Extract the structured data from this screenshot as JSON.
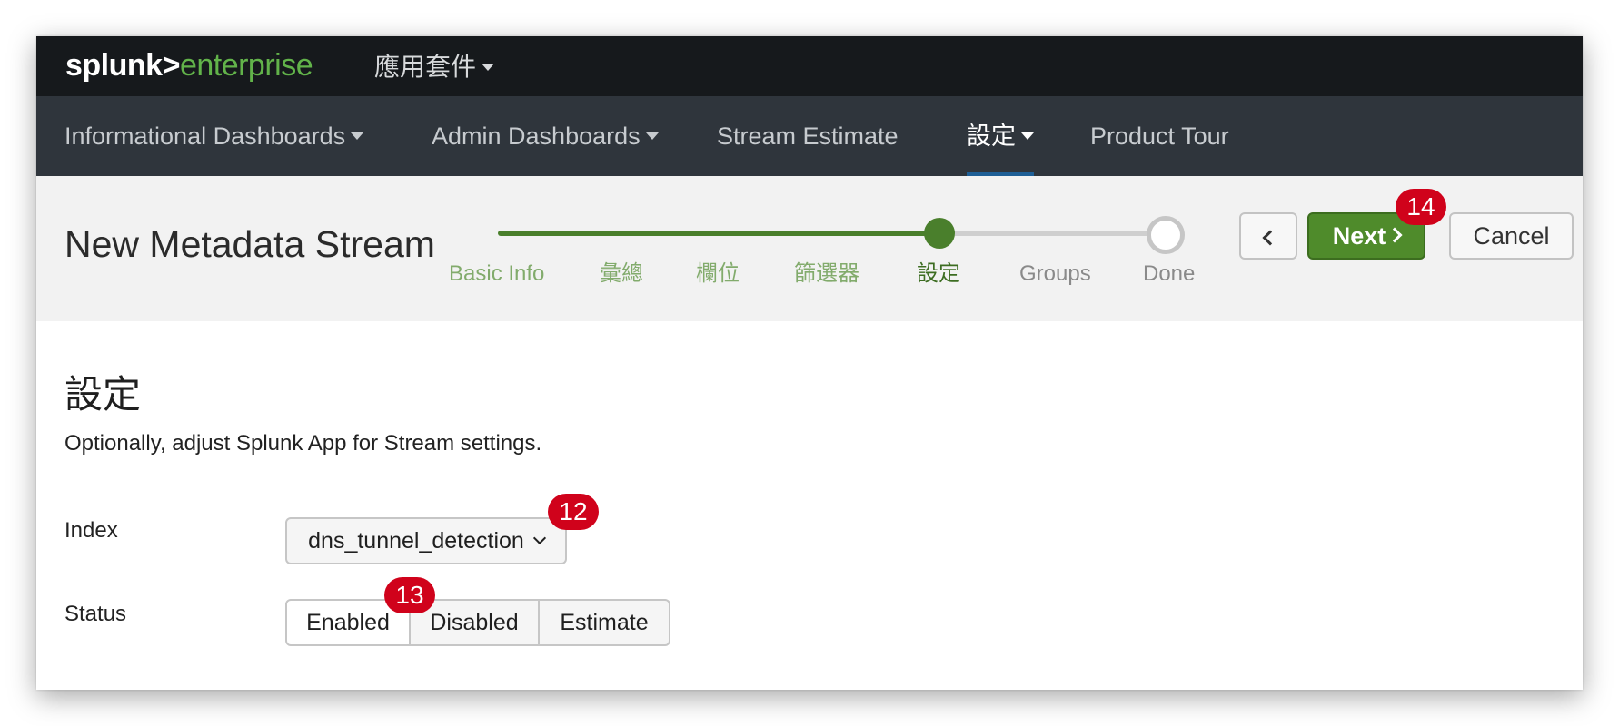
{
  "topbar": {
    "logo_brand": "splunk>",
    "logo_product": "enterprise",
    "apps_menu_label": "應用套件"
  },
  "nav": {
    "items": [
      {
        "label": "Informational Dashboards",
        "has_caret": true
      },
      {
        "label": "Admin Dashboards",
        "has_caret": true
      },
      {
        "label": "Stream Estimate",
        "has_caret": false
      },
      {
        "label": "設定",
        "has_caret": true,
        "active": true
      },
      {
        "label": "Product Tour",
        "has_caret": false
      }
    ]
  },
  "wizard": {
    "title": "New Metadata Stream",
    "steps": [
      "Basic Info",
      "彙總",
      "欄位",
      "篩選器",
      "設定",
      "Groups",
      "Done"
    ],
    "current_step": "設定",
    "buttons": {
      "next_label": "Next",
      "cancel_label": "Cancel"
    }
  },
  "content": {
    "title": "設定",
    "description": "Optionally, adjust Splunk App for Stream settings.",
    "index_label": "Index",
    "index_value": "dns_tunnel_detection",
    "status_label": "Status",
    "status_options": [
      "Enabled",
      "Disabled",
      "Estimate"
    ],
    "status_selected": "Enabled"
  },
  "badges": {
    "next": "14",
    "index": "12",
    "status": "13"
  },
  "colors": {
    "topbar_bg": "#16191c",
    "navbar_bg": "#2f353c",
    "brand_green": "#62b34a",
    "progress_green": "#4a7f2c",
    "next_button": "#4f8b2b",
    "badge_red": "#d0021b",
    "active_nav_underline": "#1e5f96"
  }
}
